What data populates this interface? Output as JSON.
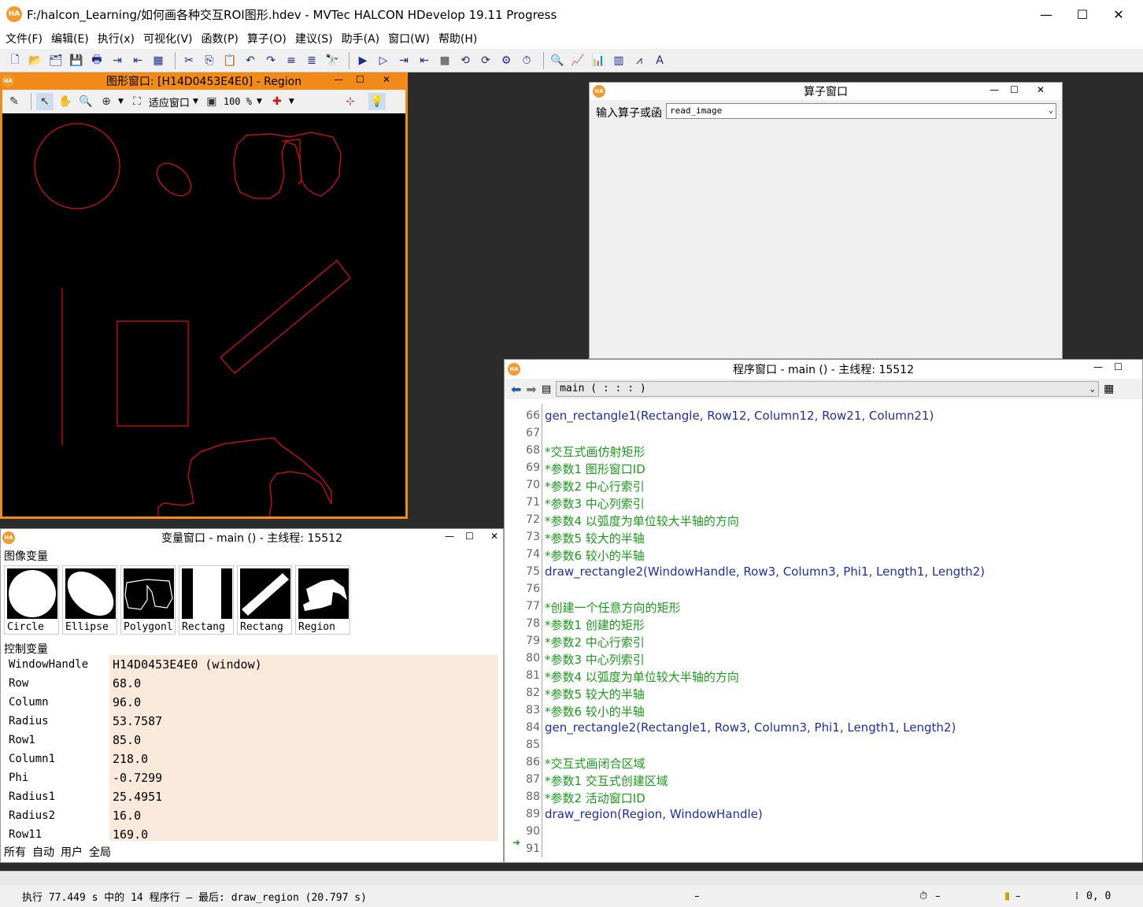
{
  "app": {
    "title": "F:/halcon_Learning/如何画各种交互ROI图形.hdev - MVTec HALCON HDevelop 19.11 Progress",
    "logo": "HA"
  },
  "menu": [
    "文件(F)",
    "编辑(E)",
    "执行(x)",
    "可视化(V)",
    "函数(P)",
    "算子(O)",
    "建议(S)",
    "助手(A)",
    "窗口(W)",
    "帮助(H)"
  ],
  "graphics_window": {
    "title": "图形窗口: [H14D0453E4E0] - Region",
    "fit_label": "适应窗口",
    "zoom_label": "100 %"
  },
  "operator_window": {
    "title": "算子窗口",
    "input_label": "输入算子或函",
    "input_value": "read_image"
  },
  "program_window": {
    "title": "程序窗口 - main () - 主线程: 15512",
    "procedure": "main ( : : : )",
    "lines": [
      {
        "n": "66",
        "text": "gen_rectangle1(Rectangle, Row12, Column12, Row21, Column21)",
        "kind": "o"
      },
      {
        "n": "67",
        "text": "",
        "kind": "o"
      },
      {
        "n": "68",
        "text": "*交互式画仿射矩形",
        "kind": "c"
      },
      {
        "n": "69",
        "text": "*参数1 图形窗口ID",
        "kind": "c"
      },
      {
        "n": "70",
        "text": "*参数2 中心行索引",
        "kind": "c"
      },
      {
        "n": "71",
        "text": "*参数3 中心列索引",
        "kind": "c"
      },
      {
        "n": "72",
        "text": "*参数4 以弧度为单位较大半轴的方向",
        "kind": "c"
      },
      {
        "n": "73",
        "text": "*参数5 较大的半轴",
        "kind": "c"
      },
      {
        "n": "74",
        "text": "*参数6 较小的半轴",
        "kind": "c"
      },
      {
        "n": "75",
        "text": "draw_rectangle2(WindowHandle, Row3, Column3, Phi1, Length1, Length2)",
        "kind": "o"
      },
      {
        "n": "76",
        "text": "",
        "kind": "o"
      },
      {
        "n": "77",
        "text": "*创建一个任意方向的矩形",
        "kind": "c"
      },
      {
        "n": "78",
        "text": "*参数1 创建的矩形",
        "kind": "c"
      },
      {
        "n": "79",
        "text": "*参数2 中心行索引",
        "kind": "c"
      },
      {
        "n": "80",
        "text": "*参数3 中心列索引",
        "kind": "c"
      },
      {
        "n": "81",
        "text": "*参数4 以弧度为单位较大半轴的方向",
        "kind": "c"
      },
      {
        "n": "82",
        "text": "*参数5 较大的半轴",
        "kind": "c"
      },
      {
        "n": "83",
        "text": "*参数6 较小的半轴",
        "kind": "c"
      },
      {
        "n": "84",
        "text": "gen_rectangle2(Rectangle1, Row3, Column3, Phi1, Length1, Length2)",
        "kind": "o"
      },
      {
        "n": "85",
        "text": "",
        "kind": "o"
      },
      {
        "n": "86",
        "text": "*交互式画闭合区域",
        "kind": "c"
      },
      {
        "n": "87",
        "text": "*参数1 交互式创建区域",
        "kind": "c"
      },
      {
        "n": "88",
        "text": "*参数2 活动窗口ID",
        "kind": "c"
      },
      {
        "n": "89",
        "text": "draw_region(Region, WindowHandle)",
        "kind": "o"
      },
      {
        "n": "90",
        "text": "",
        "kind": "o"
      },
      {
        "n": "91",
        "text": "",
        "kind": "o"
      }
    ]
  },
  "variable_window": {
    "title": "变量窗口 - main () - 主线程: 15512",
    "iconic_header": "图像变量",
    "iconic": [
      "Circle",
      "Ellipse",
      "Polygonl",
      "Rectang",
      "Rectang",
      "Region"
    ],
    "control_header": "控制变量",
    "control": [
      {
        "name": "WindowHandle",
        "value": "H14D0453E4E0 (window)"
      },
      {
        "name": "Row",
        "value": "68.0"
      },
      {
        "name": "Column",
        "value": "96.0"
      },
      {
        "name": "Radius",
        "value": "53.7587"
      },
      {
        "name": "Row1",
        "value": "85.0"
      },
      {
        "name": "Column1",
        "value": "218.0"
      },
      {
        "name": "Phi",
        "value": "-0.7299"
      },
      {
        "name": "Radius1",
        "value": "25.4951"
      },
      {
        "name": "Radius2",
        "value": "16.0"
      },
      {
        "name": "Row11",
        "value": "169.0"
      }
    ],
    "tabs": [
      "所有",
      "自动",
      "用户",
      "全局"
    ]
  },
  "status": {
    "message": "执行 77.449 s 中的 14 程序行 — 最后: draw_region (20.797 s)",
    "dash": "–",
    "timer_value": "–",
    "mem_value": "–",
    "coords": "0, 0"
  },
  "colors": {
    "graphics_frame": "#f28a1a",
    "region_stroke": "#e01010",
    "comment": "#1a9c1a",
    "operator": "#1e2ea8",
    "control_value_bg": "#faeadb"
  },
  "icons": {
    "minimize": "minimize-icon",
    "maximize": "maximize-icon",
    "close": "close-icon"
  }
}
